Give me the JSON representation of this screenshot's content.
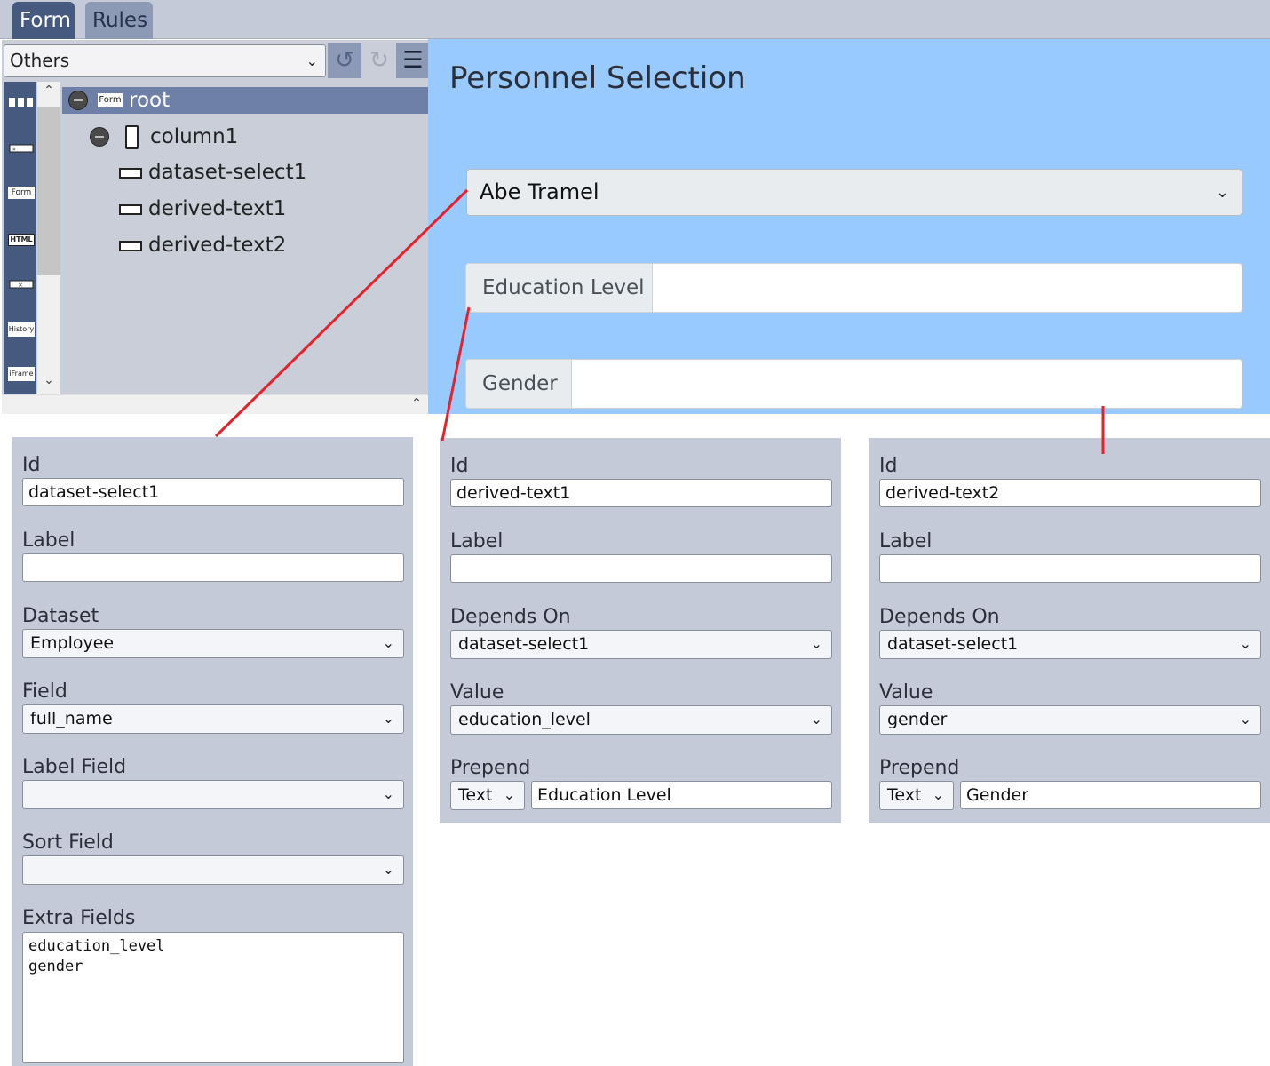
{
  "tabs": [
    {
      "label": "Form"
    },
    {
      "label": "Rules"
    }
  ],
  "designer": {
    "category_select": "Others",
    "toolbar": {
      "undo": "↺",
      "redo": "↻",
      "menu": "☰"
    },
    "palette_icons": [
      "columns-icon",
      "text-field-icon",
      "form-icon",
      "html-icon",
      "clear-field-icon",
      "history-icon",
      "iframe-icon"
    ],
    "palette_labels": {
      "form": "Form",
      "html": "HTML",
      "history": "History",
      "iframe": "iFrame"
    },
    "tree": {
      "root": {
        "badge": "Form",
        "label": "root"
      },
      "items": [
        {
          "label": "column1"
        },
        {
          "label": "dataset-select1"
        },
        {
          "label": "derived-text1"
        },
        {
          "label": "derived-text2"
        }
      ]
    }
  },
  "preview": {
    "title": "Personnel Selection",
    "person_select_value": "Abe Tramel",
    "fields": [
      {
        "prepend": "Education Level",
        "value": ""
      },
      {
        "prepend": "Gender",
        "value": ""
      }
    ]
  },
  "panels": {
    "dataset_select": {
      "id_label": "Id",
      "id_value": "dataset-select1",
      "label_label": "Label",
      "label_value": "",
      "dataset_label": "Dataset",
      "dataset_value": "Employee",
      "field_label": "Field",
      "field_value": "full_name",
      "label_field_label": "Label Field",
      "label_field_value": "",
      "sort_field_label": "Sort Field",
      "sort_field_value": "",
      "extra_fields_label": "Extra Fields",
      "extra_fields_value": "education_level\ngender"
    },
    "derived_text1": {
      "id_label": "Id",
      "id_value": "derived-text1",
      "label_label": "Label",
      "label_value": "",
      "depends_label": "Depends On",
      "depends_value": "dataset-select1",
      "value_label": "Value",
      "value_value": "education_level",
      "prepend_label": "Prepend",
      "prepend_type": "Text",
      "prepend_value": "Education Level"
    },
    "derived_text2": {
      "id_label": "Id",
      "id_value": "derived-text2",
      "label_label": "Label",
      "label_value": "",
      "depends_label": "Depends On",
      "depends_value": "dataset-select1",
      "value_label": "Value",
      "value_value": "gender",
      "prepend_label": "Prepend",
      "prepend_type": "Text",
      "prepend_value": "Gender"
    }
  },
  "colors": {
    "annotation_line": "#e8202a",
    "active_tab": "#465a80",
    "preview_bg": "#99caff",
    "panel_bg": "#c5cad8"
  }
}
